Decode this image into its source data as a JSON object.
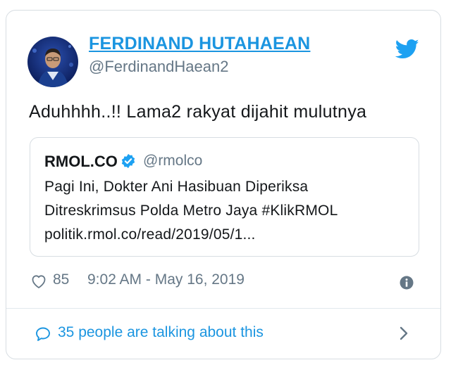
{
  "tweet": {
    "author": {
      "display_name": "FERDINAND HUTAHAEAN",
      "handle": "@FerdinandHaean2",
      "avatar_icon": "profile-photo"
    },
    "platform_icon": "twitter-bird-icon",
    "text": "Aduhhhh..!! Lama2 rakyat dijahit mulutnya",
    "quoted": {
      "name": "RMOL.CO",
      "verified": true,
      "handle": "@rmolco",
      "lines": [
        "Pagi Ini, Dokter Ani Hasibuan Diperiksa",
        "Ditreskrimsus Polda Metro Jaya #KlikRMOL",
        "politik.rmol.co/read/2019/05/1..."
      ]
    },
    "likes": "85",
    "timestamp": "9:02 AM - May 16, 2019",
    "talking": "35 people are talking about this"
  },
  "colors": {
    "accent": "#1b95e0",
    "text": "#14171a",
    "secondary": "#657786",
    "border": "#d7dde2"
  }
}
